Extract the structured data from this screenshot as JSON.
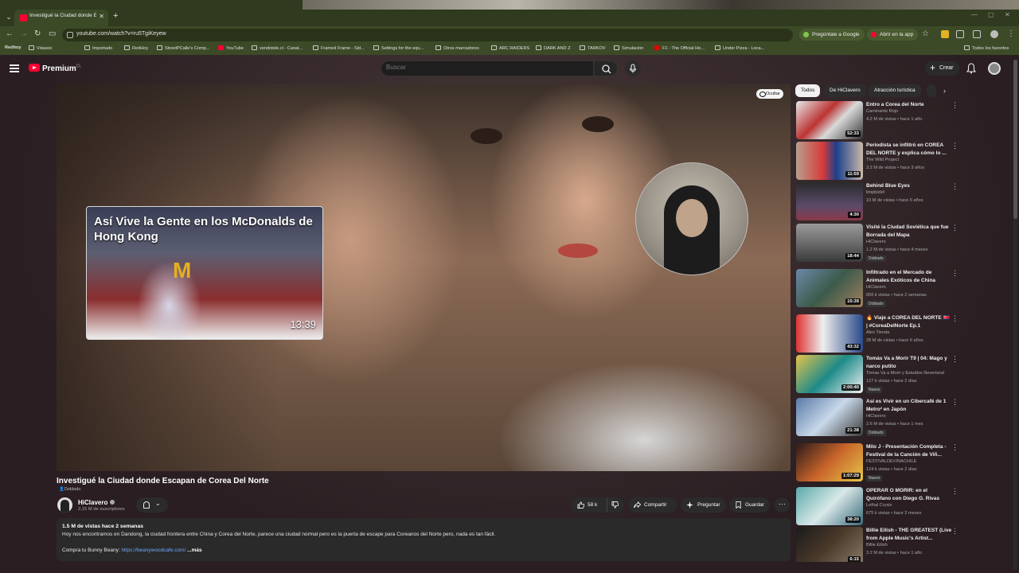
{
  "browser": {
    "tab_title": "Investigué la Ciudad donde Esc",
    "url": "youtube.com/watch?v=ru5TgiKeyew",
    "ask_google": "Pregúntale a Google",
    "open_app": "Abrir en la app",
    "bookmarks": [
      "Redhoy",
      "Vdassic",
      "Importado",
      "RedHoy",
      "StreetPCalle's Comp...",
      "YouTube",
      "vendotele.cl - Canal...",
      "Framed Frame - Sid...",
      "Settings for the equ...",
      "Otros marcadores",
      "ARC RAIDERS",
      "DARK AND Z",
      "TARKOV",
      "Simulación",
      "F1 - The Official Ho...",
      "Under Pizza - Loca..."
    ],
    "all_bookmarks": "Todos los favoritos"
  },
  "masthead": {
    "logo": "Premium",
    "country": "CL",
    "search_placeholder": "Buscar",
    "create": "Crear"
  },
  "player": {
    "hide_label": "Ocultar",
    "endcard_title": "Así Vive la Gente en los McDonalds de Hong Kong",
    "endcard_duration": "13:39",
    "endcard_logo": "M"
  },
  "video": {
    "title": "Investigué la Ciudad donde Escapan de Corea Del Norte",
    "dubbed": "Doblado",
    "channel": "HiClavero",
    "subscribers": "2,15 M de suscriptores",
    "likes": "58 k",
    "share": "Compartir",
    "ask": "Preguntar",
    "save": "Guardar",
    "desc_meta": "1.5 M de vistas  hace 2 semanas",
    "desc_body": "Hoy nos encontramos en Dandong, la ciudad frontera entre China y Corea del Norte, parece una ciudad normal pero es la puerta de escape para Coreanos del Norte pero, nada es tan fácil.",
    "desc_promo": "Compra tu Bunny Beany: ",
    "desc_link": "https://beanywoodcafe.com/",
    "desc_more": " ...más"
  },
  "sidebar": {
    "chips": [
      "Todos",
      "De HiClavero",
      "Atracción turística"
    ],
    "recs": [
      {
        "title": "Entro a Corea del Norte",
        "channel": "Caminante Rojo",
        "views": "4.2 M de vistas • hace 1 año",
        "duration": "52:33",
        "badge": ""
      },
      {
        "title": "Periodista se infiltró en COREA DEL NORTE y explica cómo lo ...",
        "channel": "The Wild Project",
        "views": "3.2 M de vistas • hace 3 años",
        "duration": "11:59",
        "badge": ""
      },
      {
        "title": "Behind Blue Eyes",
        "channel": "limpbizkit",
        "views": "10 M de vistas • hace 6 años",
        "duration": "4:30",
        "badge": ""
      },
      {
        "title": "Visité la Ciudad Soviética que fue Borrada del Mapa",
        "channel": "HiClavero",
        "views": "1.2 M de vistas • hace 4 meses",
        "duration": "18:44",
        "badge": "Doblado"
      },
      {
        "title": "Infiltrado en el Mercado de Animales Exóticos de China",
        "channel": "HiClavero",
        "views": "656 k vistas • hace 2 semanas",
        "duration": "15:39",
        "badge": "Doblado"
      },
      {
        "title": "🔥 Viaje a COREA DEL NORTE 🇰🇵 | #CoreaDelNorte Ep.1",
        "channel": "Alex Tienda",
        "views": "28 M de vistas • hace 6 años",
        "duration": "43:32",
        "badge": ""
      },
      {
        "title": "Tomás Va a Morir T9 | 04: Mago y narco putito",
        "channel": "Tomas Va a Morir y Estudios Neverland",
        "views": "127 k vistas • hace 2 días",
        "duration": "2:00:40",
        "badge": "Nuevo"
      },
      {
        "title": "Así es Vivir en un Cibercafé de 1 Metro² en Japón",
        "channel": "HiClavero",
        "views": "2.6 M de vistas • hace 1 mes",
        "duration": "21:38",
        "badge": "Doblado"
      },
      {
        "title": "Milo J - Presentación Completa - Festival de la Canción de Viñ...",
        "channel": "FESTIVALDEVINACHILE",
        "views": "124 k vistas • hace 2 días",
        "duration": "1:07:29",
        "badge": "Nuevo"
      },
      {
        "title": "OPERAR O MORIR: en el Quirófano con Diego G. Rivas",
        "channel": "Lethal Crysis",
        "views": "675 k vistas • hace 2 meses",
        "duration": "38:20",
        "badge": ""
      },
      {
        "title": "Billie Eilish - THE GREATEST (Live from Apple Music's Artist...",
        "channel": "Billie Eilish",
        "views": "3.2 M de vistas • hace 1 año",
        "duration": "6:15",
        "badge": ""
      }
    ]
  },
  "colors": {
    "accent": "#ff0033",
    "chrome": "#3d4a28",
    "page_bg": "#3a2a2c"
  }
}
